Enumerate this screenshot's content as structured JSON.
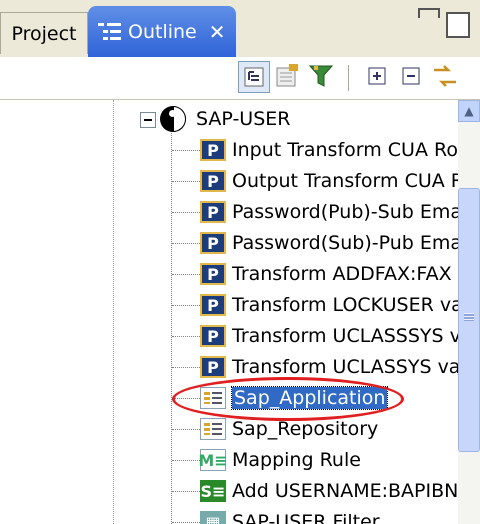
{
  "tabs": {
    "project_label": "Project",
    "outline_label": "Outline",
    "close_glyph": "✕"
  },
  "toolbar": {
    "buttons": [
      "hierarchy-icon",
      "filter-icon",
      "funnel-icon",
      "expand-all-icon",
      "collapse-all-icon",
      "sync-icon"
    ]
  },
  "tree": {
    "root_label": "SAP-USER",
    "items": [
      {
        "label": "Input Transform CUA Rol",
        "icon": "policy-icon"
      },
      {
        "label": "Output Transform CUA R",
        "icon": "policy-icon"
      },
      {
        "label": "Password(Pub)-Sub Emai",
        "icon": "policy-icon"
      },
      {
        "label": "Password(Sub)-Pub Emai",
        "icon": "policy-icon"
      },
      {
        "label": "Transform ADDFAX:FAX",
        "icon": "policy-icon"
      },
      {
        "label": "Transform LOCKUSER va",
        "icon": "policy-icon"
      },
      {
        "label": "Transform UCLASSSYS va",
        "icon": "policy-icon"
      },
      {
        "label": "Transform UCLASSYS val",
        "icon": "policy-icon"
      },
      {
        "label": "Sap_Application",
        "icon": "application-icon",
        "selected": true
      },
      {
        "label": "Sap_Repository",
        "icon": "application-icon"
      },
      {
        "label": "Mapping Rule",
        "icon": "mapping-rule-icon"
      },
      {
        "label": "Add USERNAME:BAPIBNA",
        "icon": "script-icon"
      },
      {
        "label": "SAP-USER Filter",
        "icon": "filter-icon"
      }
    ]
  },
  "colors": {
    "tab_active": "#2f63d8",
    "selection": "#316ac5",
    "annotation": "#e02020"
  }
}
